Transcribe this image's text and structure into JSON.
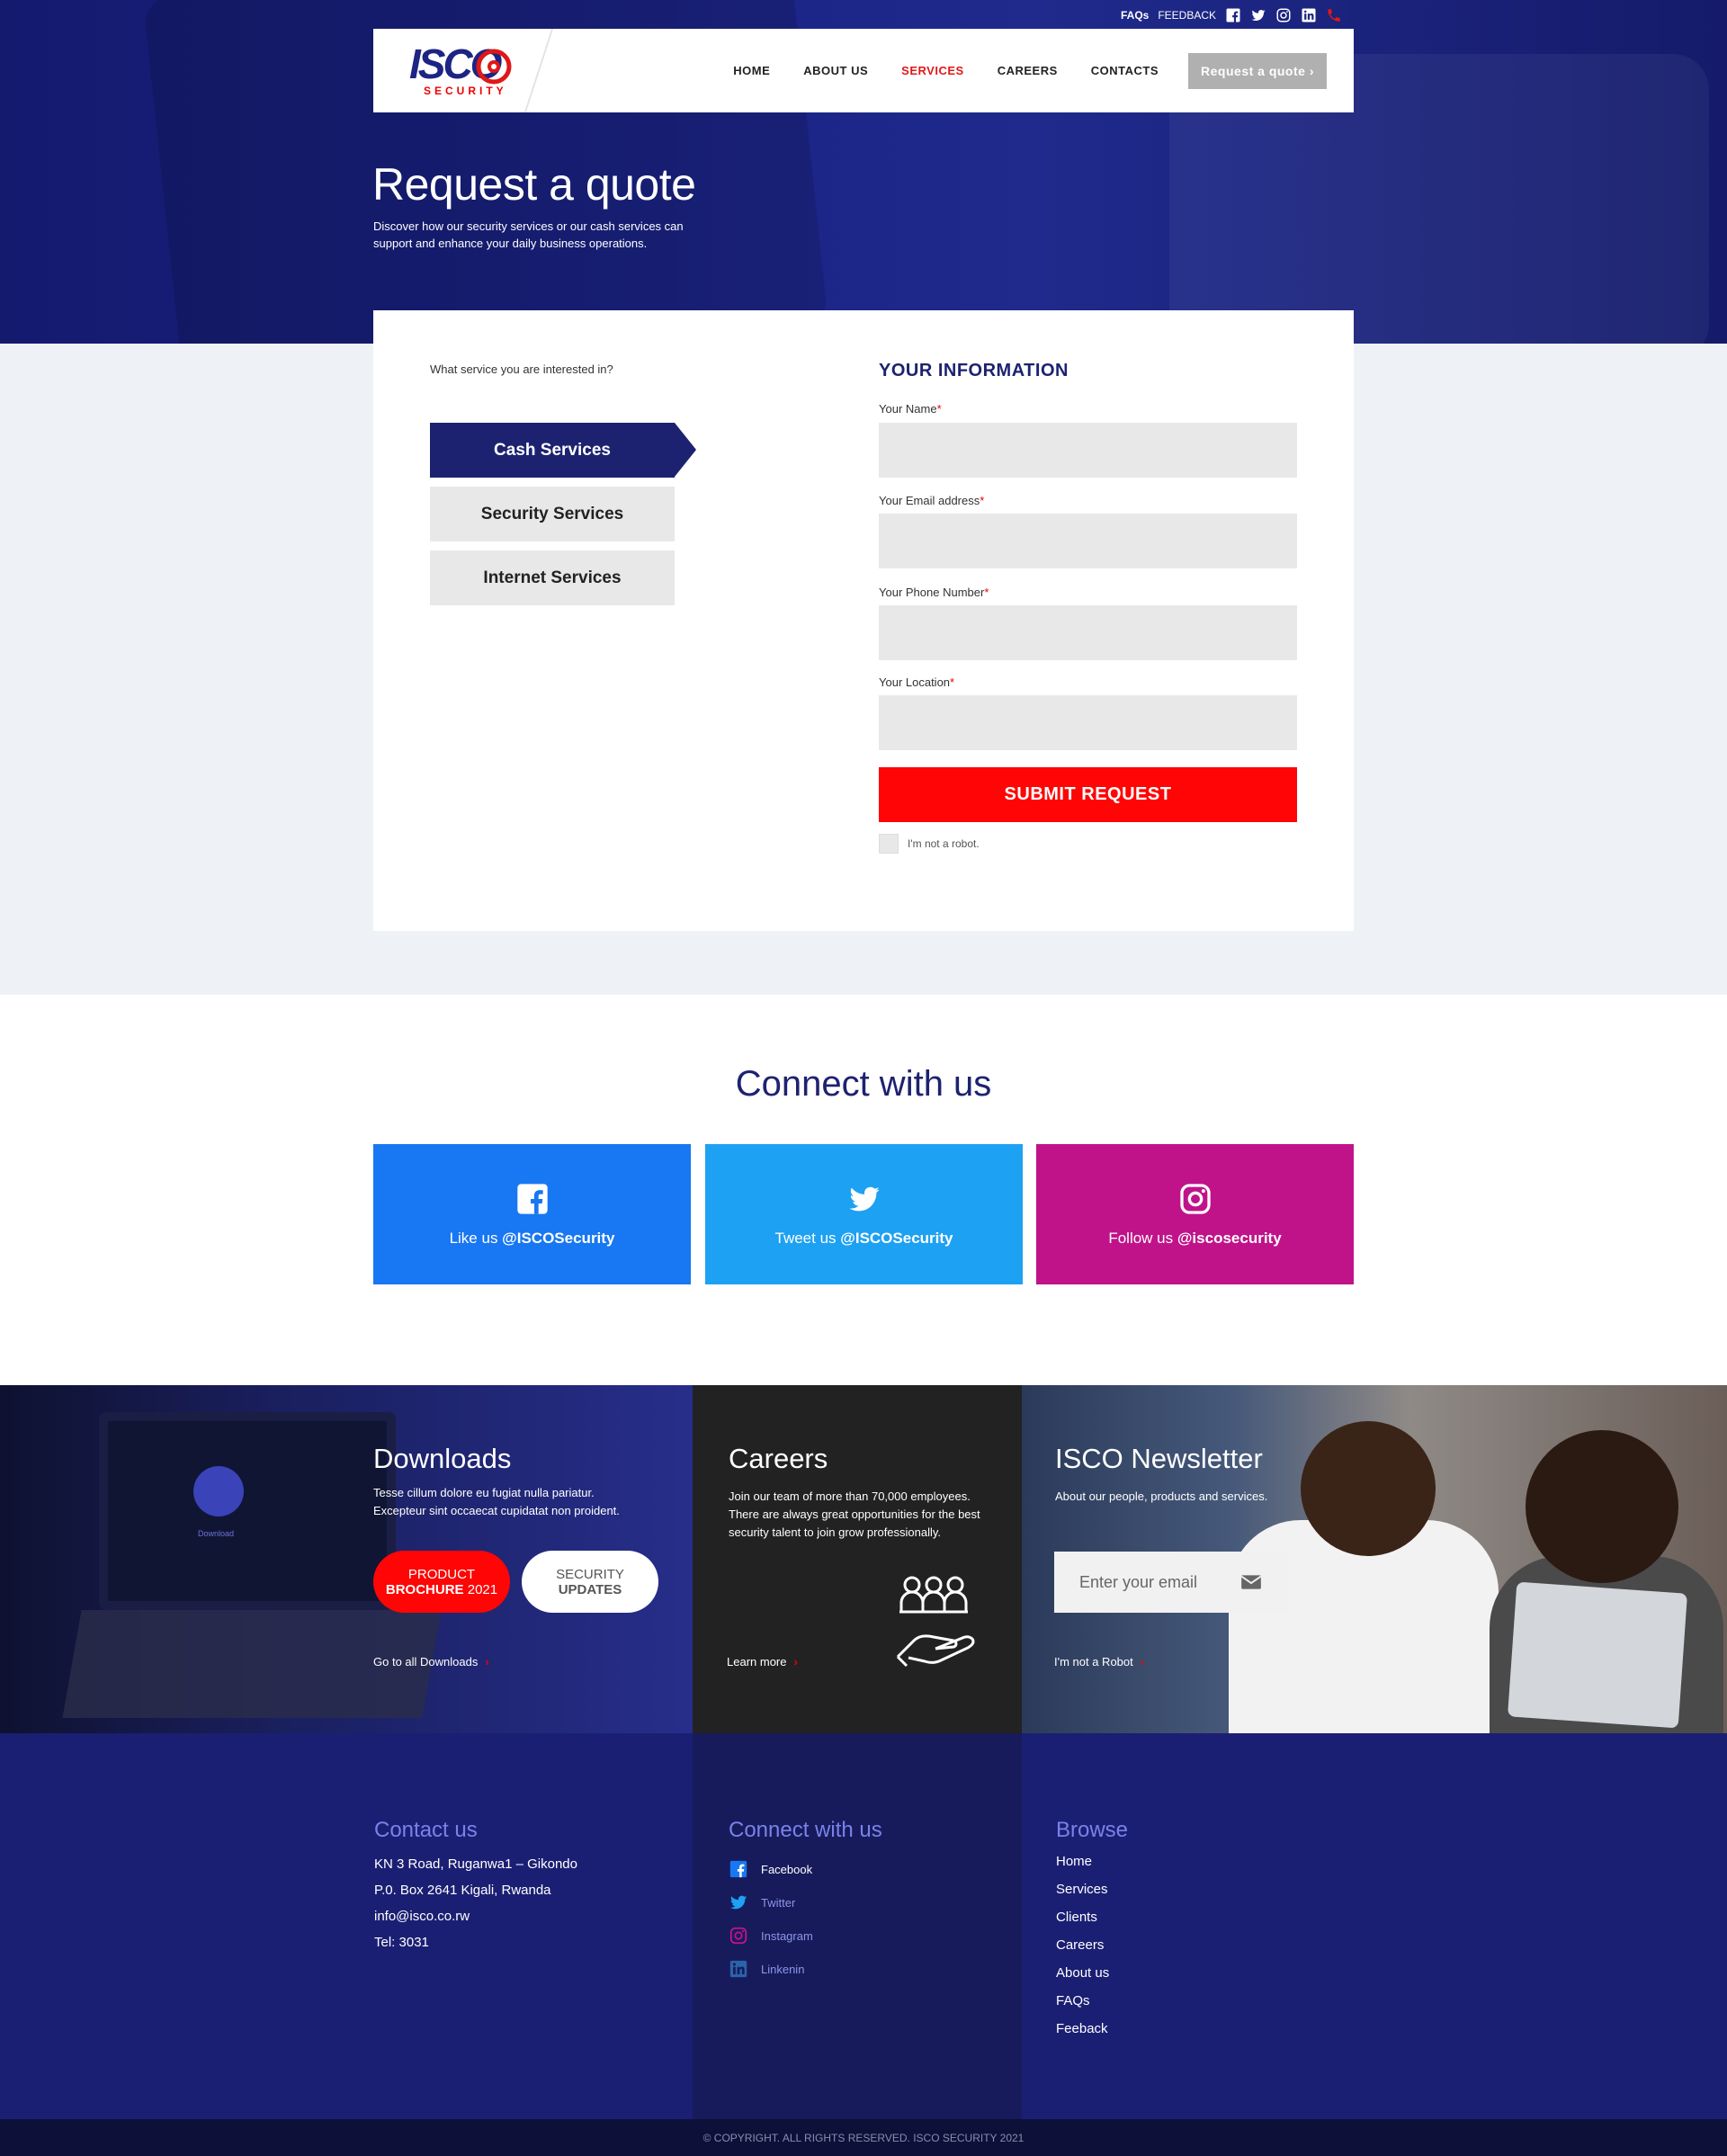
{
  "topbar": {
    "faqs": "FAQs",
    "feedback": "FEEDBACK"
  },
  "brand": {
    "name": "ISCO",
    "tag": "SECURITY",
    "primary": "#1d2270",
    "accent": "#ff0505"
  },
  "nav": {
    "home": "HOME",
    "about": "ABOUT US",
    "services": "SERVICES",
    "careers": "CAREERS",
    "contacts": "CONTACTS",
    "quote": "Request a quote"
  },
  "hero": {
    "title": "Request a quote",
    "subtitle": "Discover how our security services or our cash services can support and enhance your daily business operations."
  },
  "form": {
    "question": "What  service you are interested in?",
    "services": [
      "Cash Services",
      "Security Services",
      "Internet Services"
    ],
    "section_title": "YOUR INFORMATION",
    "fields": [
      {
        "label": "Your Name",
        "value": ""
      },
      {
        "label": "Your Email address",
        "value": ""
      },
      {
        "label": "Your Phone Number",
        "value": ""
      },
      {
        "label": "Your Location",
        "value": ""
      }
    ],
    "submit": "SUBMIT REQUEST",
    "captcha": "I'm not a robot."
  },
  "connect": {
    "title": "Connect with us",
    "cards": [
      {
        "pre": "Like us ",
        "handle": "@ISCOSecurity",
        "color": "#1877f2",
        "icon": "facebook-icon"
      },
      {
        "pre": "Tweet us ",
        "handle": "@ISCOSecurity",
        "color": "#1da1f2",
        "icon": "twitter-icon"
      },
      {
        "pre": "Follow us ",
        "handle": "@iscosecurity",
        "color": "#c0138a",
        "icon": "instagram-icon"
      }
    ]
  },
  "downloads": {
    "title": "Downloads",
    "text": "Tesse cillum dolore eu fugiat nulla pariatur. Excepteur sint occaecat cupidatat non proident.",
    "pill1_top": "PRODUCT",
    "pill1_bold": "BROCHURE",
    "pill1_year": " 2021",
    "pill2_top": "SECURITY",
    "pill2_bold": "UPDATES",
    "link": "Go to all Downloads",
    "screen_label": "Download"
  },
  "careers": {
    "title": "Careers",
    "text": "Join our team of more than 70,000 employees. There are always great opportunities for the best security talent to join grow professionally.",
    "link": "Learn more"
  },
  "newsletter": {
    "title": "ISCO Newsletter",
    "text": "About our people, products and services.",
    "placeholder": "Enter your email",
    "link": "I'm not a Robot"
  },
  "footer": {
    "contact_title": "Contact us",
    "contact_lines": [
      "KN 3 Road, Ruganwa1 – Gikondo",
      "P.0. Box 2641 Kigali, Rwanda",
      "info@isco.co.rw",
      "Tel: 3031"
    ],
    "connect_title": "Connect with us",
    "social": [
      "Facebook",
      "Twitter",
      "Instagram",
      "Linkenin"
    ],
    "browse_title": "Browse",
    "browse": [
      "Home",
      "Services",
      "Clients",
      "Careers",
      "About us",
      "FAQs",
      "Feeback"
    ],
    "copyright": "© COPYRIGHT. ALL RIGHTS RESERVED. ISCO SECURITY 2021"
  }
}
